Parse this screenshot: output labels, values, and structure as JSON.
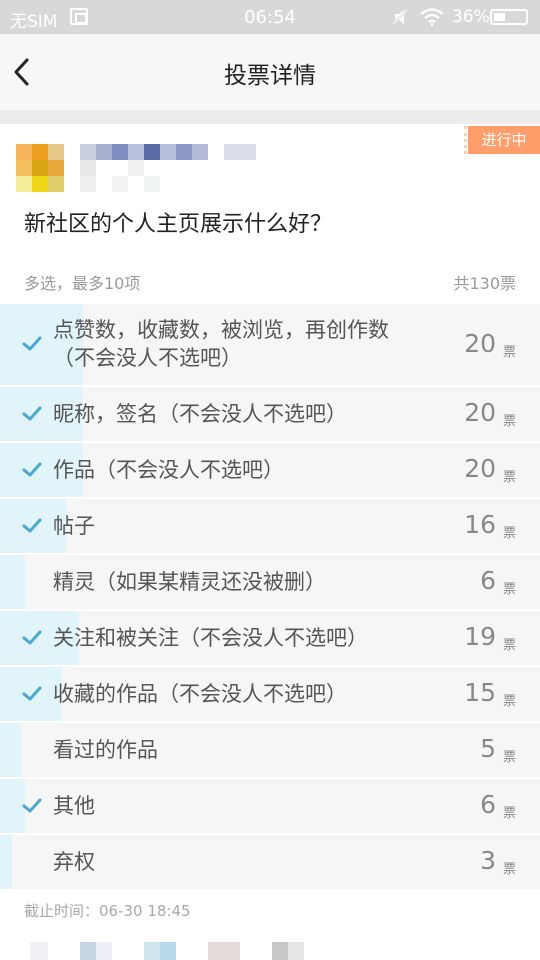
{
  "status_bar": {
    "sim": "无SIM",
    "time": "06:54",
    "battery": "36%"
  },
  "nav": {
    "title": "投票详情"
  },
  "post": {
    "status_tag": "进行中",
    "question": "新社区的个人主页展示什么好？",
    "mode": "多选，最多10项",
    "total": "共130票"
  },
  "options": [
    {
      "label": "点赞数，收藏数，被浏览，再创作数（不会没人不选吧）",
      "count": "20",
      "unit": "票",
      "checked": true,
      "share": 0.154
    },
    {
      "label": "昵称，签名（不会没人不选吧）",
      "count": "20",
      "unit": "票",
      "checked": true,
      "share": 0.154
    },
    {
      "label": "作品（不会没人不选吧）",
      "count": "20",
      "unit": "票",
      "checked": true,
      "share": 0.154
    },
    {
      "label": "帖子",
      "count": "16",
      "unit": "票",
      "checked": true,
      "share": 0.123
    },
    {
      "label": "精灵（如果某精灵还没被删）",
      "count": "6",
      "unit": "票",
      "checked": false,
      "share": 0.046
    },
    {
      "label": "关注和被关注（不会没人不选吧）",
      "count": "19",
      "unit": "票",
      "checked": true,
      "share": 0.146
    },
    {
      "label": "收藏的作品（不会没人不选吧）",
      "count": "15",
      "unit": "票",
      "checked": true,
      "share": 0.115
    },
    {
      "label": "看过的作品",
      "count": "5",
      "unit": "票",
      "checked": false,
      "share": 0.038
    },
    {
      "label": "其他",
      "count": "6",
      "unit": "票",
      "checked": true,
      "share": 0.046
    },
    {
      "label": "弃权",
      "count": "3",
      "unit": "票",
      "checked": false,
      "share": 0.023
    }
  ],
  "deadline": "截止时间：06-30 18:45",
  "colors": {
    "accent_bar": "#e0f4fa",
    "check": "#4aa8cf",
    "tag": "#ff9e6b"
  },
  "icons": {
    "back": "back-icon",
    "check": "check-icon",
    "wifi": "wifi-icon",
    "mute": "mute-icon",
    "battery": "battery-icon",
    "screenshot": "screenshot-icon"
  }
}
